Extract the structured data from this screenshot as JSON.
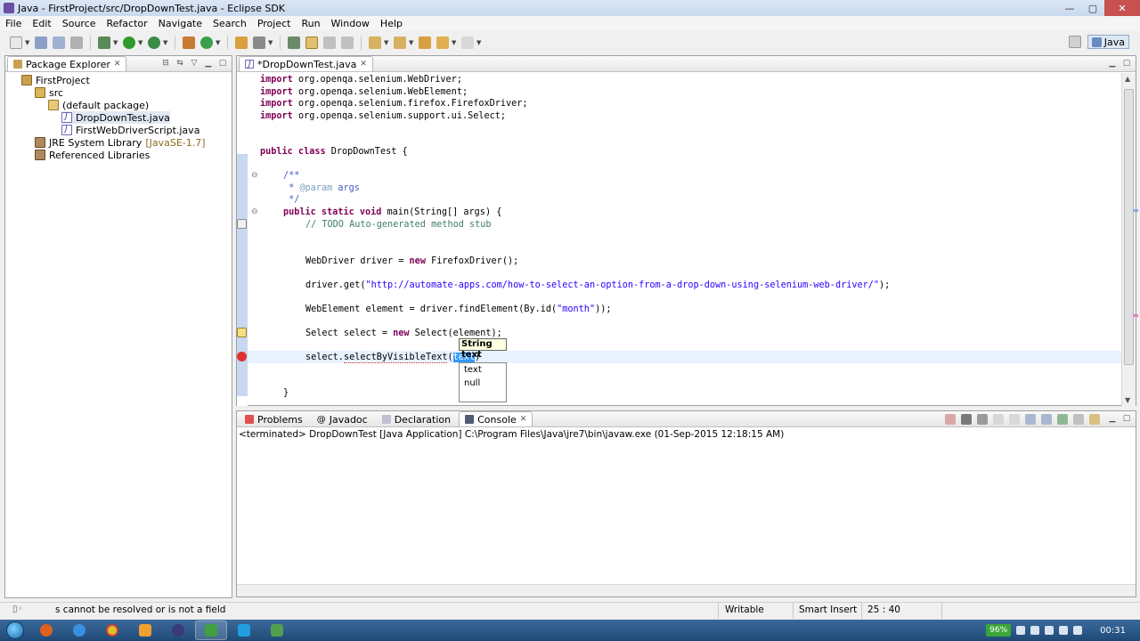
{
  "window": {
    "title": "Java - FirstProject/src/DropDownTest.java - Eclipse SDK",
    "controls": {
      "minimize": "—",
      "maximize": "▢",
      "close": "✕"
    }
  },
  "menu": [
    "File",
    "Edit",
    "Source",
    "Refactor",
    "Navigate",
    "Search",
    "Project",
    "Run",
    "Window",
    "Help"
  ],
  "perspective": {
    "label": "Java"
  },
  "package_explorer": {
    "title": "Package Explorer",
    "tree": [
      {
        "label": "FirstProject",
        "icon": "project-icon"
      },
      {
        "label": "src",
        "icon": "source-folder-icon"
      },
      {
        "label": "(default package)",
        "icon": "package-icon"
      },
      {
        "label": "DropDownTest.java",
        "icon": "java-file-icon"
      },
      {
        "label": "FirstWebDriverScript.java",
        "icon": "java-file-icon"
      },
      {
        "label": "JRE System Library",
        "tag": "[JavaSE-1.7]",
        "icon": "library-icon"
      },
      {
        "label": "Referenced Libraries",
        "icon": "library-icon"
      }
    ]
  },
  "editor": {
    "tab": "*DropDownTest.java",
    "lines": {
      "l1a": "import",
      "l1b": " org.openqa.selenium.WebDriver;",
      "l2a": "import",
      "l2b": " org.openqa.selenium.WebElement;",
      "l3a": "import",
      "l3b": " org.openqa.selenium.firefox.FirefoxDriver;",
      "l4a": "import",
      "l4b": " org.openqa.selenium.support.ui.Select;",
      "l5a": "public class",
      "l5b": " DropDownTest {",
      "l6": "/**",
      "l7a": " * ",
      "l7b": "@param",
      "l7c": " args",
      "l8": " */",
      "l9a": "public static void",
      "l9b": " main(String[] args) {",
      "l10": "// TODO Auto-generated method stub",
      "l11a": "WebDriver driver = ",
      "l11b": "new",
      "l11c": " FirefoxDriver();",
      "l12a": "driver.get(",
      "l12b": "\"http://automate-apps.com/how-to-select-an-option-from-a-drop-down-using-selenium-web-driver/\"",
      "l12c": ");",
      "l13a": "WebElement element = driver.findElement(By.id(",
      "l13b": "\"month\"",
      "l13c": "));",
      "l14a": "Select select = ",
      "l14b": "new",
      "l14c": " Select(element);",
      "l15a": "select.",
      "l15b": "selectByVisibleText",
      "l15c": "(",
      "l15d": "text",
      "l15e": ")",
      "l16": "}"
    },
    "tooltip": "String text",
    "assist_options": [
      "text",
      "null"
    ]
  },
  "console": {
    "tabs": [
      "Problems",
      "Javadoc",
      "Declaration",
      "Console"
    ],
    "status": "<terminated> DropDownTest [Java Application] C:\\Program Files\\Java\\jre7\\bin\\javaw.exe (01-Sep-2015 12:18:15 AM)"
  },
  "statusbar": {
    "message": "s cannot be resolved or is not a field",
    "mode": "Writable",
    "insert": "Smart Insert",
    "position": "25 : 40"
  },
  "taskbar": {
    "battery": "96%",
    "clock": "00:31"
  },
  "colors": {
    "keyword": "#7f0055",
    "comment": "#3f7f5f",
    "string": "#2a00ff",
    "javadoc": "#3f5fbf"
  }
}
